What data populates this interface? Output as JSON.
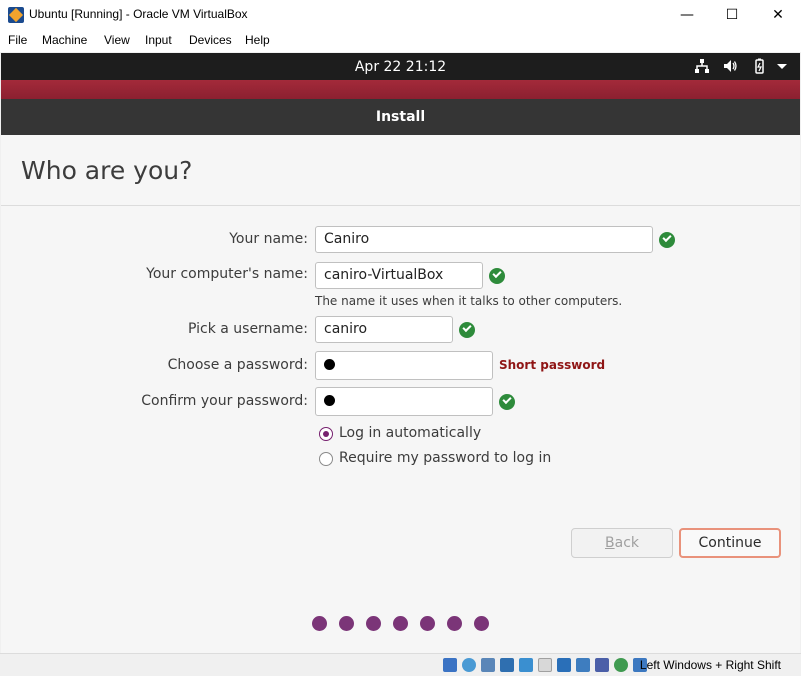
{
  "window": {
    "title": "Ubuntu [Running] - Oracle VM VirtualBox",
    "minimize": "—",
    "maximize": "☐",
    "close": "✕"
  },
  "menu": [
    "File",
    "Machine",
    "View",
    "Input",
    "Devices",
    "Help"
  ],
  "topbar": {
    "clock": "Apr 22  21:12",
    "icons": [
      "network-icon",
      "volume-icon",
      "battery-icon",
      "system-menu-arrow-icon"
    ]
  },
  "installer": {
    "header_title": "Install",
    "page_title": "Who are you?",
    "fields": {
      "name": {
        "label": "Your name:",
        "value": "Caniro"
      },
      "computer": {
        "label": "Your computer's name:",
        "value": "caniro-VirtualBox",
        "hint": "The name it uses when it talks to other computers."
      },
      "username": {
        "label": "Pick a username:",
        "value": "caniro"
      },
      "password": {
        "label": "Choose a password:",
        "warning": "Short password"
      },
      "confirm": {
        "label": "Confirm your password:"
      }
    },
    "login_options": {
      "auto": "Log in automatically",
      "require": "Require my password to log in",
      "selected": "auto"
    },
    "buttons": {
      "back": "Back",
      "continue": "Continue"
    },
    "progress": {
      "total_steps": 7
    },
    "colors": {
      "accent": "#77216f",
      "check": "#2e8b3b",
      "warning": "#8f1515",
      "header": "#353535",
      "brand_strip": "#a32a3a"
    }
  },
  "statusbar": {
    "host_key": "Left Windows + Right Shift"
  }
}
